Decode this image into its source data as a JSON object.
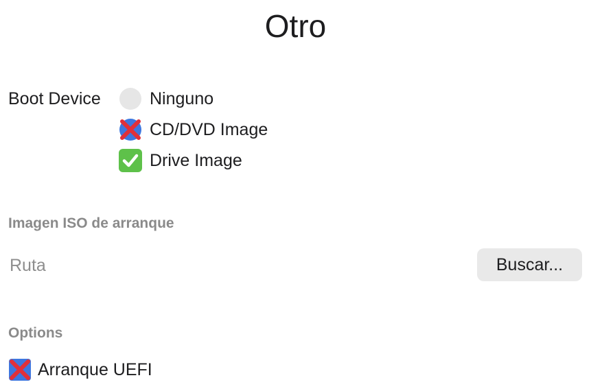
{
  "page": {
    "title": "Otro"
  },
  "boot": {
    "label": "Boot Device",
    "options": [
      {
        "label": "Ninguno",
        "state": "empty",
        "icon": "empty-radio-icon"
      },
      {
        "label": "CD/DVD Image",
        "state": "cross",
        "icon": "cross-mark-icon"
      },
      {
        "label": "Drive Image",
        "state": "check",
        "icon": "check-mark-icon"
      }
    ]
  },
  "iso": {
    "header": "Imagen ISO de arranque",
    "path_placeholder": "Ruta",
    "browse_label": "Buscar..."
  },
  "options": {
    "header": "Options",
    "uefi_label": "Arranque UEFI",
    "uefi_icon": "cross-mark-icon"
  },
  "colors": {
    "cross_red": "#e0303a",
    "check_green": "#5ec14a",
    "selected_blue": "#3d77e0",
    "header_gray": "#8a8a8a"
  }
}
